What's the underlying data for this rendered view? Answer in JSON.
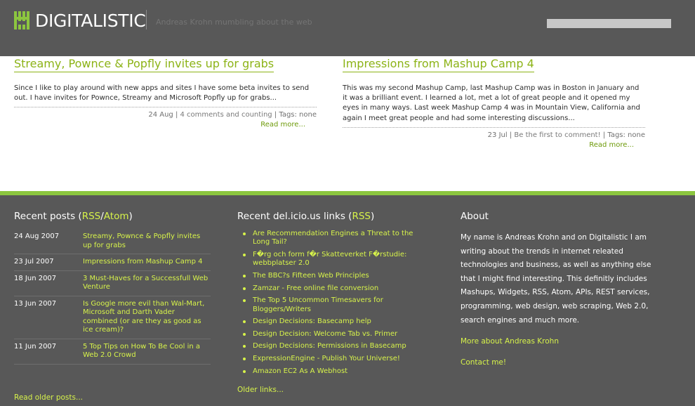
{
  "header": {
    "logo_text": "DIGITALISTIC",
    "tagline": "Andreas Krohn mumbling about the web",
    "search_value": ""
  },
  "posts": [
    {
      "title": "Streamy, Pownce & Popfly invites up for grabs",
      "excerpt": "Since I like to play around with new apps and sites I have some beta invites to send out. I have invites for Pownce, Streamy and Microsoft Popfly up for grabs...",
      "date": "24 Aug",
      "comments": "4 comments and counting",
      "tags": "Tags: none",
      "more": "Read more..."
    },
    {
      "title": "Impressions from Mashup Camp 4",
      "excerpt": "This was my second Mashup Camp, last Mashup Camp was in Boston in January and it was a brilliant event. I learned a lot, met a lot of great people and it opened my eyes in many ways. Last week Mashup Camp 4 was in Mountain View, California and again I meet great people and had some interesting discussions...",
      "date": "23 Jul",
      "comments": "Be the first to comment!",
      "tags": "Tags: none",
      "more": "Read more..."
    }
  ],
  "recent": {
    "heading": "Recent posts (",
    "rss": "RSS",
    "slash": "/",
    "atom": "Atom",
    "close": ")",
    "items": [
      {
        "date": "24 Aug 2007",
        "title": "Streamy, Pownce & Popfly invites up for grabs"
      },
      {
        "date": "23 Jul 2007",
        "title": "Impressions from Mashup Camp 4"
      },
      {
        "date": "18 Jun 2007",
        "title": "3 Must-Haves for a Successfull Web Venture"
      },
      {
        "date": "13 Jun 2007",
        "title": "Is Google more evil than Wal-Mart, Microsoft and Darth Vader combined (or are they as good as ice cream)?"
      },
      {
        "date": "11 Jun 2007",
        "title": "5 Top Tips on How To Be Cool in a Web 2.0 Crowd"
      }
    ],
    "older": "Read older posts..."
  },
  "delicious": {
    "heading": "Recent del.icio.us links (",
    "rss": "RSS",
    "close": ")",
    "links": [
      "Are Recommendation Engines a Threat to the Long Tail?",
      "F�rg och form f�r Skatteverket F�rstudie: webbplatser 2.0",
      "The BBC?s Fifteen Web Principles",
      "Zamzar - Free online file conversion",
      "The Top 5 Uncommon Timesavers for Bloggers/Writers",
      "Design Decisions: Basecamp help",
      "Design Decision: Welcome Tab vs. Primer",
      "Design Decisions: Permissions in Basecamp",
      "ExpressionEngine - Publish Your Universe!",
      "Amazon EC2 As A Webhost"
    ],
    "older": "Older links..."
  },
  "about": {
    "heading": "About",
    "text": "My name is Andreas Krohn and on Digitalistic I am writing about the trends in internet releated technologies and business, as well as anything else that I might find interesting. This definitly includes Mashups, Widgets, RSS, Atom, APIs, REST services, programming, web design, web scraping, Web 2.0, search engines and much more.",
    "more_link": "More about Andreas Krohn",
    "contact_link": "Contact me!"
  },
  "colors": {
    "accent": "#8cb316",
    "footer_link": "#d7f34a",
    "bar": "#8cc63f",
    "background": "#585858"
  }
}
